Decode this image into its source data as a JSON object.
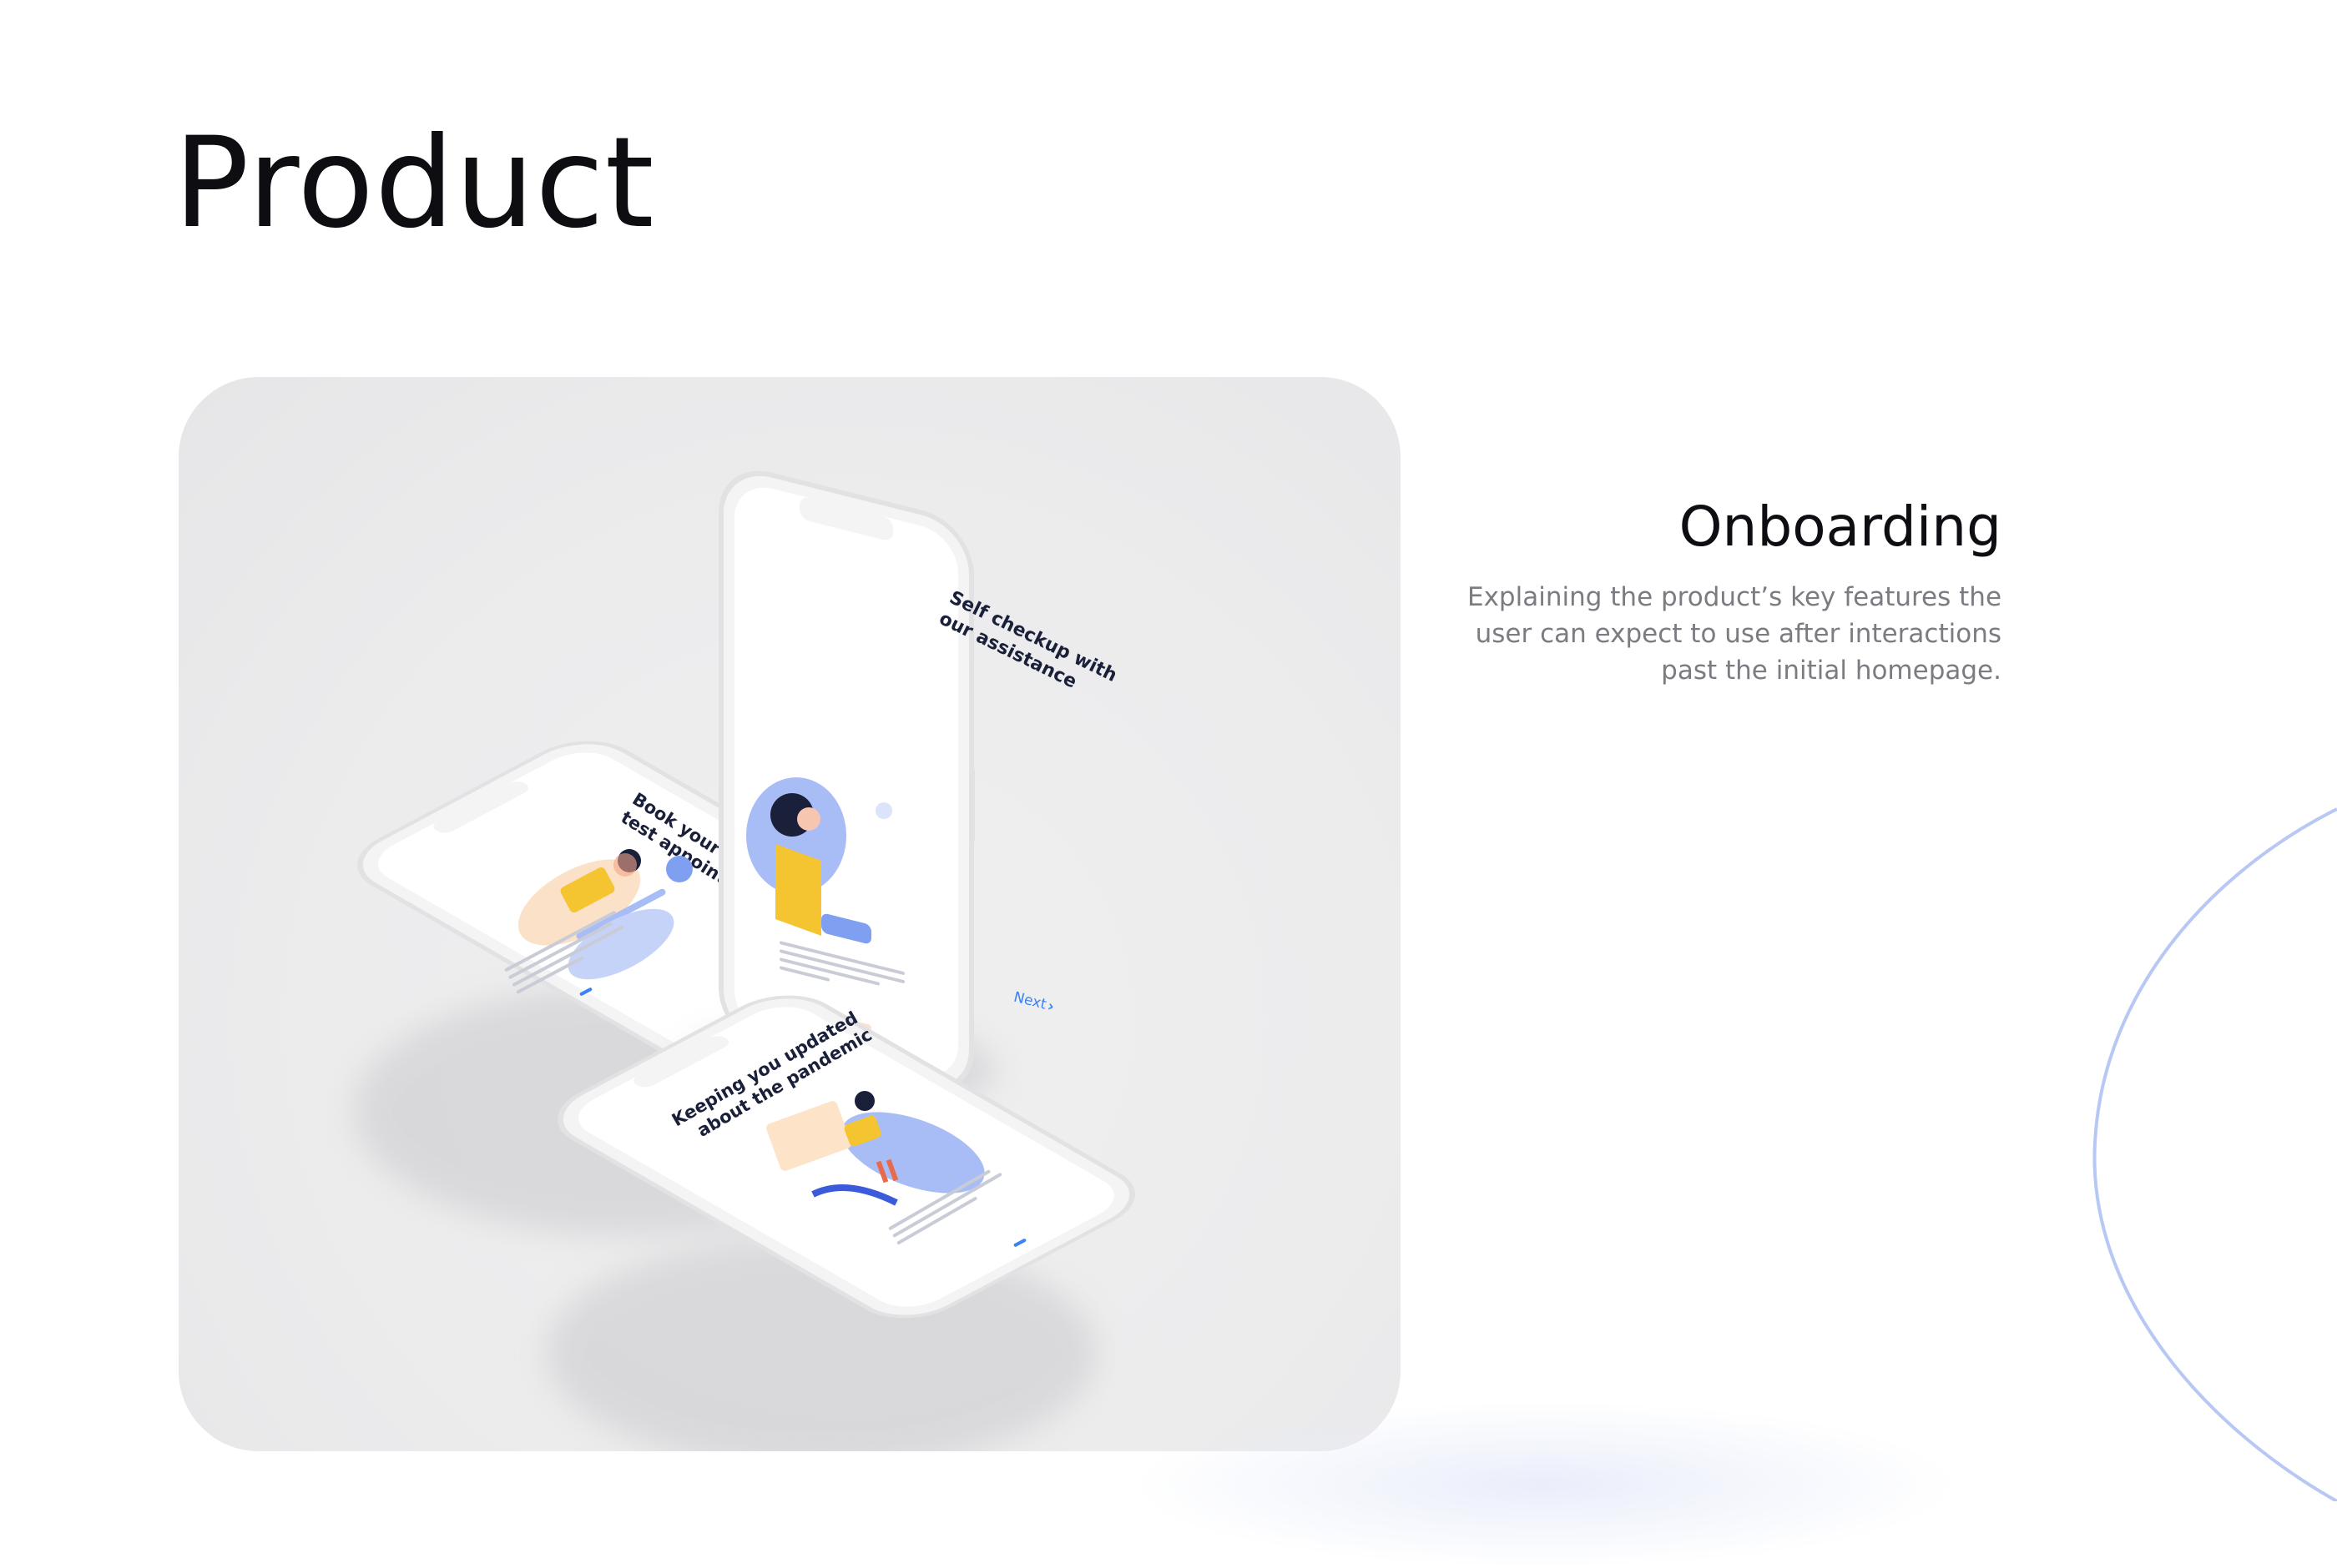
{
  "page": {
    "title": "Product"
  },
  "section": {
    "title": "Onboarding",
    "description": "Explaining the product’s key features the user can expect to use after interactions past the initial homepage."
  },
  "phones": [
    {
      "heading_line1": "Book your covid",
      "heading_line2": "test appointment"
    },
    {
      "heading_line1": "Self checkup with",
      "heading_line2": "our assistance",
      "next_label": "Next"
    },
    {
      "heading_line1": "Keeping you updated",
      "heading_line2": "about the pandemic"
    }
  ],
  "colors": {
    "accent_blue": "#3b82f6",
    "illustration_blue": "#a8bdf5",
    "illustration_yellow": "#f5c431",
    "deco_curve": "#b8c8f5",
    "text_dark": "#0d0d12",
    "text_muted": "#7b7b82"
  }
}
